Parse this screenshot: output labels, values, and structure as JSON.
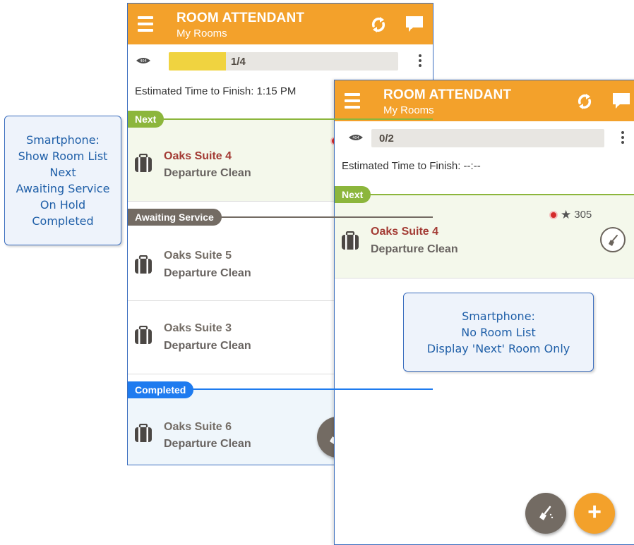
{
  "callout_left": {
    "lines": [
      "Smartphone:",
      "Show Room List",
      "Next",
      "Awaiting Service",
      "On Hold",
      "Completed"
    ]
  },
  "callout_right": {
    "lines": [
      "Smartphone:",
      "No Room List",
      "Display 'Next' Room Only"
    ]
  },
  "phone_a": {
    "header": {
      "title": "ROOM ATTENDANT",
      "subtitle": "My Rooms"
    },
    "progress": {
      "text": "1/4",
      "fill_fraction": 0.25
    },
    "eta": "Estimated Time to Finish: 1:15 PM",
    "sections": {
      "next": "Next",
      "awaiting": "Awaiting Service",
      "completed": "Completed"
    },
    "rooms": [
      {
        "name": "Oaks Suite 4",
        "task": "Departure Clean"
      },
      {
        "name": "Oaks Suite 5",
        "task": "Departure Clean"
      },
      {
        "name": "Oaks Suite 3",
        "task": "Departure Clean"
      },
      {
        "name": "Oaks Suite 6",
        "task": "Departure Clean"
      }
    ]
  },
  "phone_b": {
    "header": {
      "title": "ROOM ATTENDANT",
      "subtitle": "My Rooms"
    },
    "progress": {
      "text": "0/2",
      "fill_fraction": 0
    },
    "eta": "Estimated Time to Finish: --:--",
    "sections": {
      "next": "Next"
    },
    "rooms": [
      {
        "name": "Oaks Suite 4",
        "task": "Departure Clean",
        "points": "305"
      }
    ],
    "fab_add_label": "+"
  },
  "colors": {
    "header": "#f3a12b",
    "next": "#8cb63c",
    "awaiting": "#736b63",
    "completed": "#1e7bef",
    "next_bg": "#f4f8eb",
    "completed_bg": "#eff6fb",
    "room_next_name": "#a33b34",
    "progress_fill": "#f0d340"
  },
  "icons": [
    "menu-icon",
    "sync-icon",
    "message-icon",
    "eye-icon",
    "more-vert-icon",
    "suitcase-icon",
    "priority-dot-icon",
    "star-icon",
    "broom-icon",
    "plus-icon"
  ]
}
